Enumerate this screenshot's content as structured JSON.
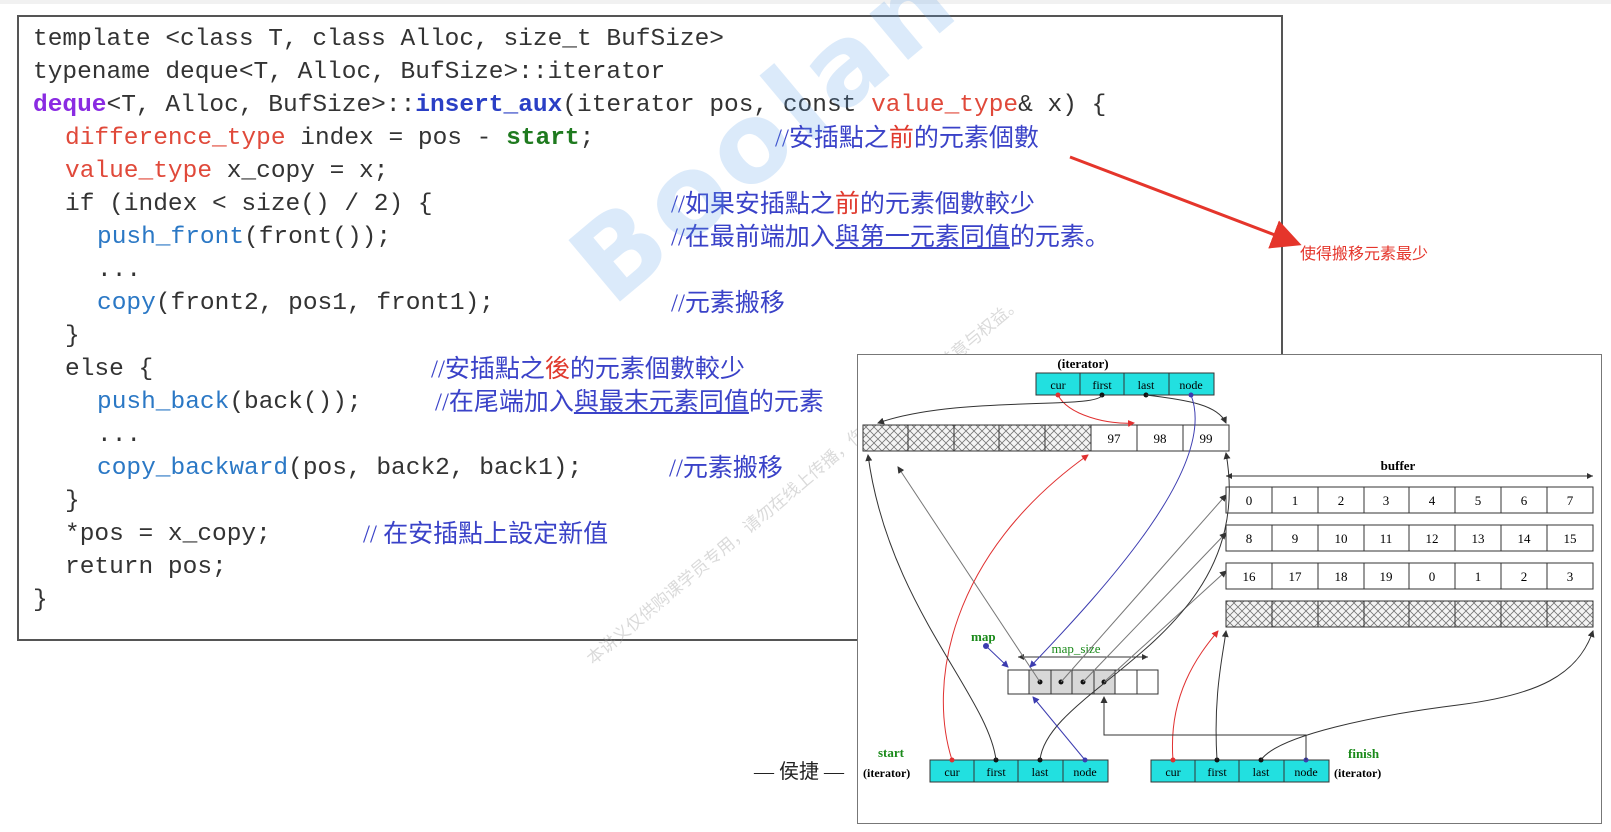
{
  "code": {
    "l1": "template <class T, class Alloc, size_t BufSize>",
    "l2": "typename deque<T, Alloc, BufSize>::iterator",
    "l3_kw": "deque",
    "l3_a": "<T, Alloc, BufSize>::",
    "l3_fn": "insert_aux",
    "l3_b": "(iterator pos, const ",
    "l3_vt": "value_type",
    "l3_c": "& x) {",
    "l4_type": "difference_type",
    "l4_a": " index = pos - ",
    "l4_start": "start",
    "l4_b": ";",
    "l5_type": "value_type",
    "l5_a": " x_copy = x;",
    "l6": "if (index < size() / 2) {",
    "l7_fn": "push_front",
    "l7_a": "(front());",
    "l8": "...",
    "l9_fn": "copy",
    "l9_a": "(front2, pos1, front1);",
    "l10": "}",
    "l11": "else {",
    "l12_fn": "push_back",
    "l12_a": "(back());",
    "l13": "...",
    "l14_fn": "copy_backward",
    "l14_a": "(pos, back2, back1);",
    "l15": "}",
    "l16": "*pos = x_copy;",
    "l17": "return pos;",
    "l18": "}"
  },
  "comments": {
    "c4_a": "//安插點之",
    "c4_red": "前",
    "c4_b": "的元素個數",
    "c6_a": "//如果安插點之",
    "c6_red": "前",
    "c6_b": "的元素個數較少",
    "c7_a": "//在最前端加入",
    "c7_ul": "與第一元素同值",
    "c7_b": "的元素。",
    "c9": "//元素搬移",
    "c11_a": "//安插點之",
    "c11_red": "後",
    "c11_b": "的元素個數較少",
    "c12_a": "//在尾端加入",
    "c12_ul": "與最末元素同值",
    "c12_b": "的元素",
    "c14": "//元素搬移",
    "c16": "// 在安插點上設定新值"
  },
  "note": "使得搬移元素最少",
  "watermark": {
    "main": "Boolan 博览网",
    "sub": "本讲义仅供购课学员专用，请勿在线上传播，伤害侯捷老师的美意与权益。"
  },
  "author": "— 侯捷 —",
  "diagram": {
    "iterator_label": "(iterator)",
    "iter_fields": [
      "cur",
      "first",
      "last",
      "node"
    ],
    "top_buffer_values": [
      "97",
      "98",
      "99"
    ],
    "buffer_label": "buffer",
    "buffer_rows": [
      [
        "0",
        "1",
        "2",
        "3",
        "4",
        "5",
        "6",
        "7"
      ],
      [
        "8",
        "9",
        "10",
        "11",
        "12",
        "13",
        "14",
        "15"
      ],
      [
        "16",
        "17",
        "18",
        "19",
        "0",
        "1",
        "2",
        "3"
      ]
    ],
    "map_label": "map",
    "map_size_label": "map_size",
    "start_label": "start",
    "finish_label": "finish",
    "start_sub": "(iterator)",
    "finish_sub": "(iterator)"
  },
  "colors": {
    "code_purple": "#8a2be2",
    "code_red": "#e0493a",
    "code_blue": "#2b78c5",
    "code_green": "#1f7a1f",
    "comment_blue": "#3a42c8",
    "accent_red": "#e5352b",
    "iterator_cyan": "#22e0e0",
    "diagram_green": "#1a8a1a"
  }
}
